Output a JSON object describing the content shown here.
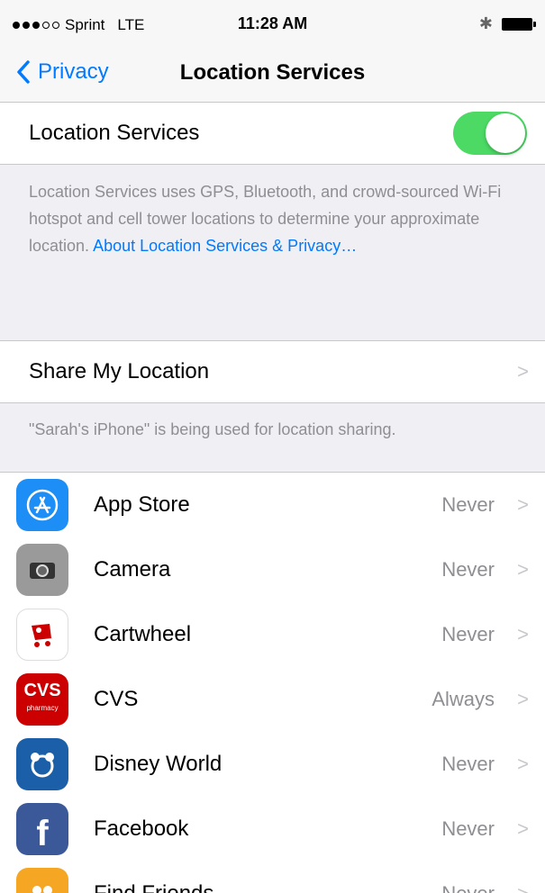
{
  "status_bar": {
    "carrier": "Sprint",
    "network": "LTE",
    "time": "11:28 AM"
  },
  "nav": {
    "back_label": "Privacy",
    "title": "Location Services"
  },
  "location_services": {
    "label": "Location Services",
    "enabled": true,
    "footer_text": "Location Services uses GPS, Bluetooth, and crowd-sourced Wi-Fi hotspot and cell tower locations to determine your approximate location.",
    "footer_link": "About Location Services & Privacy…"
  },
  "share_location": {
    "label": "Share My Location",
    "footer_text": "\"Sarah's iPhone\" is being used for location sharing."
  },
  "apps": [
    {
      "name": "App Store",
      "status": "Never",
      "icon": "app-store-icon",
      "color": "#1c8ef5"
    },
    {
      "name": "Camera",
      "status": "Never",
      "icon": "camera-icon",
      "color": "#9a9a9a"
    },
    {
      "name": "Cartwheel",
      "status": "Never",
      "icon": "cartwheel-icon",
      "color": "#ffffff"
    },
    {
      "name": "CVS",
      "status": "Always",
      "icon": "cvs-icon",
      "color": "#cc0000"
    },
    {
      "name": "Disney World",
      "status": "Never",
      "icon": "disney-world-icon",
      "color": "#1a5fa8"
    },
    {
      "name": "Facebook",
      "status": "Never",
      "icon": "facebook-icon",
      "color": "#3b5998"
    },
    {
      "name": "Find Friends",
      "status": "Never",
      "icon": "find-friends-icon",
      "color": "#f5a623"
    }
  ],
  "colors": {
    "accent": "#007aff",
    "toggle_on": "#4cd964",
    "background": "#efeff4"
  }
}
